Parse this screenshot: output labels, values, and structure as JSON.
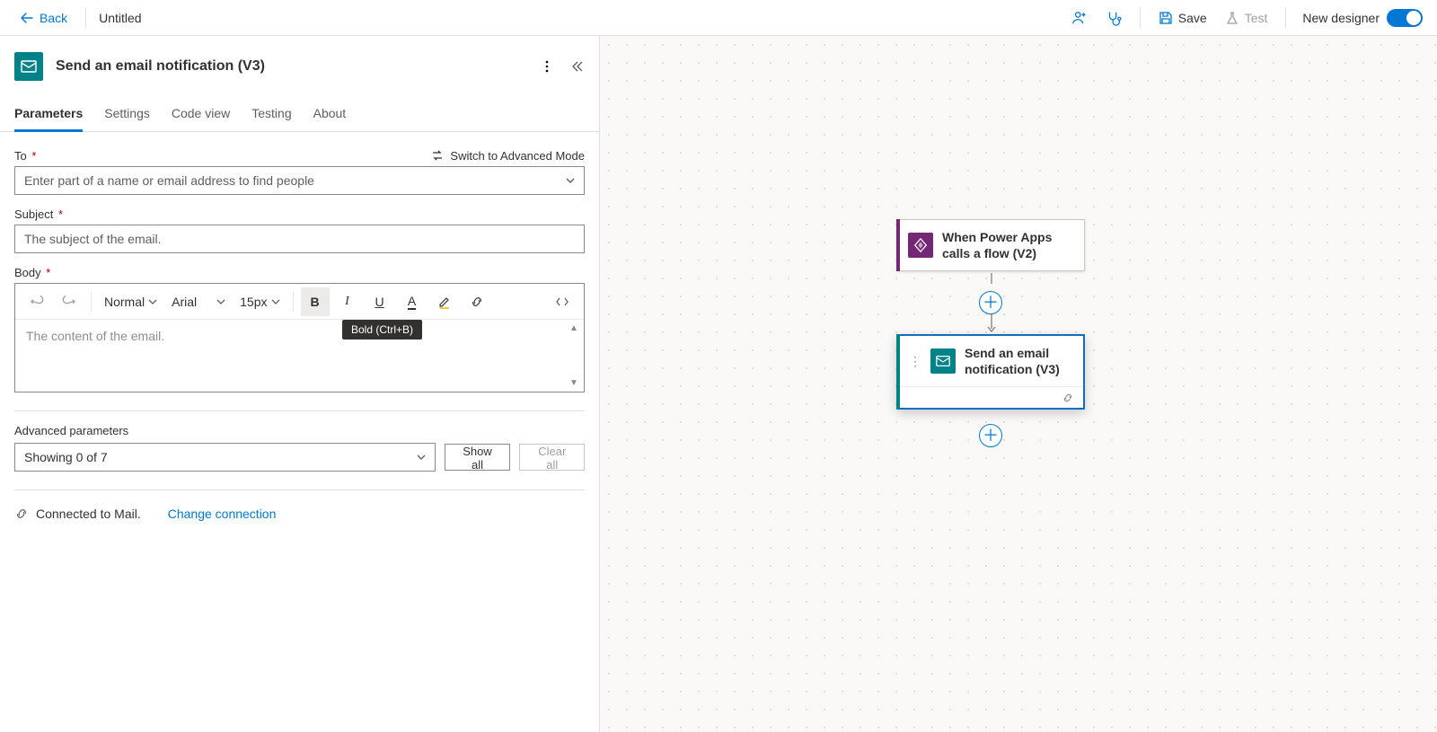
{
  "topbar": {
    "back": "Back",
    "title": "Untitled",
    "save": "Save",
    "test": "Test",
    "new_designer": "New designer"
  },
  "panel": {
    "title": "Send an email notification (V3)",
    "icon_color": "#038387"
  },
  "tabs": [
    {
      "label": "Parameters",
      "active": true
    },
    {
      "label": "Settings",
      "active": false
    },
    {
      "label": "Code view",
      "active": false
    },
    {
      "label": "Testing",
      "active": false
    },
    {
      "label": "About",
      "active": false
    }
  ],
  "advanced_link": "Switch to Advanced Mode",
  "fields": {
    "to": {
      "label": "To",
      "placeholder": "Enter part of a name or email address to find people"
    },
    "subject": {
      "label": "Subject",
      "placeholder": "The subject of the email."
    },
    "body": {
      "label": "Body",
      "placeholder": "The content of the email."
    }
  },
  "editor_toolbar": {
    "style": "Normal",
    "font": "Arial",
    "size": "15px",
    "bold_tooltip": "Bold (Ctrl+B)"
  },
  "advanced": {
    "label": "Advanced parameters",
    "showing": "Showing 0 of 7",
    "show_all": "Show all",
    "clear_all": "Clear all"
  },
  "connection": {
    "status": "Connected to Mail.",
    "change": "Change connection"
  },
  "canvas": {
    "node1": {
      "title": "When Power Apps calls a flow (V2)",
      "accent": "#742774",
      "icon_bg": "#742774"
    },
    "node2": {
      "title": "Send an email notification (V3)",
      "accent": "#038387",
      "icon_bg": "#038387"
    }
  }
}
